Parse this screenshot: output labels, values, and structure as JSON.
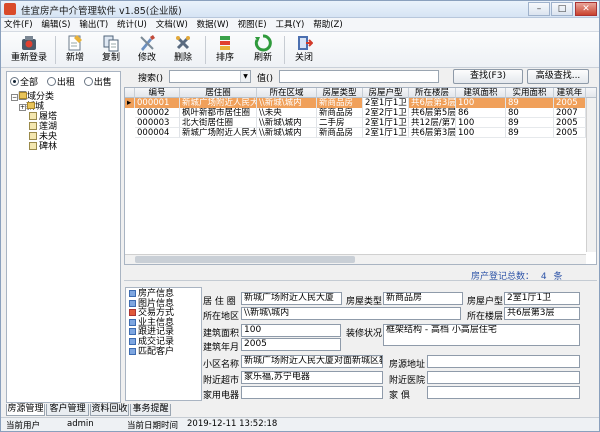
{
  "window": {
    "title": "佳宜房产中介管理软件 v1.85(企业版)",
    "min": "–",
    "max": "□",
    "close": "✕"
  },
  "menu": [
    "文件(F)",
    "编辑(S)",
    "输出(T)",
    "统计(U)",
    "文档(W)",
    "数据(W)",
    "视图(E)",
    "工具(Y)",
    "帮助(Z)"
  ],
  "toolbar": {
    "relogin": "重新登录",
    "add": "新增",
    "copy": "复制",
    "edit": "修改",
    "delete": "删除",
    "sort": "排序",
    "refresh": "刷新",
    "close": "关闭"
  },
  "filter": {
    "all": "全部",
    "rent": "出租",
    "sale": "出售",
    "selected": "all"
  },
  "tree": {
    "root": "区域分类",
    "children": [
      "新城",
      "履塔",
      "莲湖",
      "未央",
      "碑林"
    ]
  },
  "search": {
    "search_label": "搜索()",
    "search_value": "",
    "value_label": "值()",
    "value_value": "",
    "find_btn": "查找(F3)",
    "advanced_btn": "高级查找..."
  },
  "grid": {
    "columns": [
      "编号",
      "居住圈",
      "所在区域",
      "房屋类型",
      "房屋户型",
      "所在楼层",
      "建筑面积",
      "实用面积",
      "建筑年"
    ],
    "rows": [
      [
        "000001",
        "新城广场附近人民大",
        "\\\\新城\\城内",
        "新商品房",
        "2室1厅1卫",
        "共6层第3层",
        "100",
        "89",
        "2005"
      ],
      [
        "000002",
        "枫叶新都市居住圈",
        "\\\\未央",
        "新商品房",
        "2室2厅1卫",
        "共6层第5层",
        "86",
        "80",
        "2007"
      ],
      [
        "000003",
        "北大街居住圈",
        "\\\\新城\\城内",
        "二手房",
        "2室1厅1卫",
        "共12层/第7层",
        "100",
        "89",
        "2005"
      ],
      [
        "000004",
        "新城广场附近人民大",
        "\\\\新城\\城内",
        "新商品房",
        "2室1厅1卫",
        "共6层第3层",
        "100",
        "89",
        "2005"
      ]
    ],
    "selected_row": 0
  },
  "count": {
    "label": "房产登记总数：",
    "value": "4",
    "unit": "条"
  },
  "nav": [
    "房产信息",
    "图片信息",
    "交易方式",
    "业主信息",
    "跟进记录",
    "成交记录",
    "匹配客户"
  ],
  "detail": {
    "community_label": "居 住 圈",
    "community": "新城广场附近人民大厦",
    "type_label": "房屋类型",
    "type": "新商品房",
    "layout_label": "房屋户型",
    "layout": "2室1厅1卫",
    "region_label": "所在地区",
    "region": "\\\\新城\\城内",
    "floor_label": "所在楼层",
    "floor": "共6层第3层",
    "area_label": "建筑面积",
    "area": "100",
    "decor_label": "装修状况",
    "decor": "框架结构 - 高档 小高层住宅",
    "year_label": "建筑年月",
    "year": "2005",
    "community_name_label": "小区名称",
    "community_name": "新城广场附近人民大厦对面新城区教育",
    "address_label": "房源地址",
    "address": "",
    "market_label": "附近超市",
    "market": "家乐福,苏宁电器",
    "hospital_label": "附近医院",
    "hospital": "",
    "appliance_label": "家用电器",
    "appliance": "",
    "furniture_label": "家    俱",
    "furniture": ""
  },
  "tabs": [
    "房源管理",
    "客户管理",
    "资料回收",
    "事务提醒"
  ],
  "status": {
    "user_label": "当前用户",
    "user": "admin",
    "time_label": "当前日期时间",
    "time": "2019-12-11 13:52:18"
  }
}
